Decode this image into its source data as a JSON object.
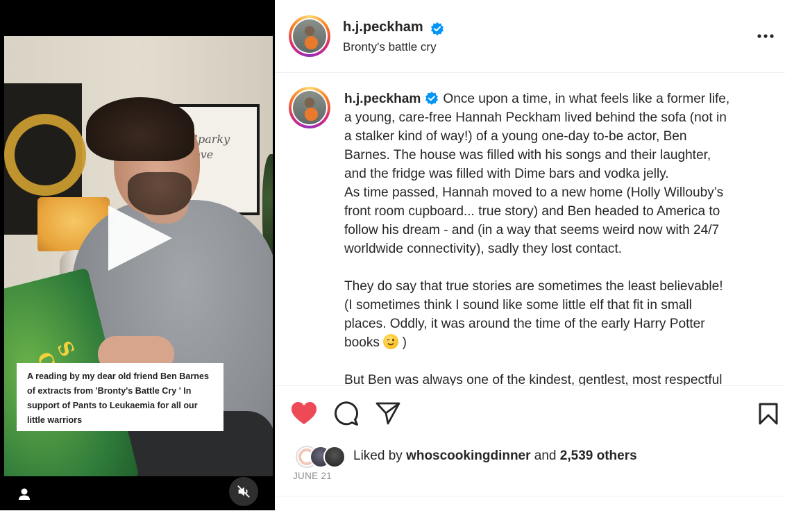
{
  "post": {
    "username": "h.j.peckham",
    "subtitle": "Bronty's battle cry",
    "verified": true,
    "caption_lines": [
      "Once upon a time, in what feels like a former life,",
      "a young, care-free Hannah Peckham lived behind the sofa (not in",
      "a stalker kind of way!) of a young one-day to-be actor, Ben",
      "Barnes.  The house was filled with his songs and their laughter,",
      "and the fridge was filled with Dime bars and vodka jelly.",
      "As time passed, Hannah moved to a new home (Holly Willouby’s",
      "front room cupboard... true story) and Ben headed to America to",
      "follow his dream - and (in a way that seems weird now with 24/7",
      "worldwide connectivity), sadly they lost contact."
    ],
    "caption_para2_lines": [
      "They do say that true stories are sometimes the least believable!",
      "(I sometimes think I sound like some little elf that fit in small",
      "places.  Oddly, it was around the time of the early Harry Potter",
      "books",
      ")"
    ],
    "caption_para3_partial": "But Ben was always one of the kindest, gentlest, most respectful"
  },
  "video": {
    "overlay_text": "A reading by my dear old friend Ben Barnes of extracts from 'Bronty's Battle Cry ' In support of Pants to Leukaemia for all our little warriors",
    "book_title_fragment": "S CRY",
    "art_script_text": "Sparky love",
    "play_icon": "play-icon",
    "mute_icon": "speaker-muted-icon",
    "tag_icon": "person-tag-icon"
  },
  "actions": {
    "liked": true,
    "like_color": "#ed4956",
    "liked_by_prefix": "Liked by",
    "liked_by_user": "whoscookingdinner",
    "liked_by_joiner": "and",
    "others_count": "2,539 others",
    "date": "JUNE 21"
  },
  "colors": {
    "verified": "#0095f6",
    "text": "#262626",
    "muted": "#8e8e8e"
  }
}
